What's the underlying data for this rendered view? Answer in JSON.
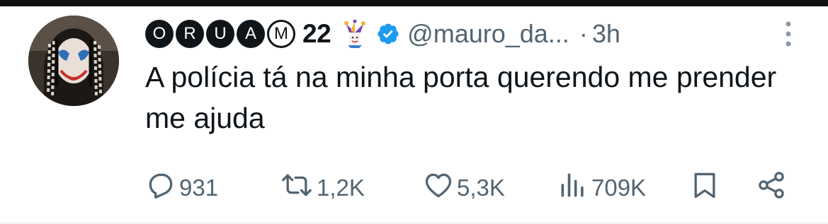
{
  "tweet": {
    "author": {
      "name_letters": [
        "O",
        "R",
        "U",
        "A",
        "M"
      ],
      "name_number": "22",
      "name_emoji": "jester-emoji",
      "verified": true,
      "handle": "@mauro_da...",
      "separator": "·",
      "time": "3h"
    },
    "text": "A polícia tá na minha porta querendo me prender me ajuda",
    "stats": {
      "replies": "931",
      "reposts": "1,2K",
      "likes": "5,3K",
      "views": "709K"
    }
  },
  "colors": {
    "text": "#0f1419",
    "secondary": "#536471",
    "verified": "#1d9bf0",
    "top_bar": "#111111"
  },
  "icons": [
    "reply-icon",
    "repost-icon",
    "like-icon",
    "views-icon",
    "bookmark-icon",
    "share-icon",
    "more-icon",
    "verified-icon"
  ]
}
